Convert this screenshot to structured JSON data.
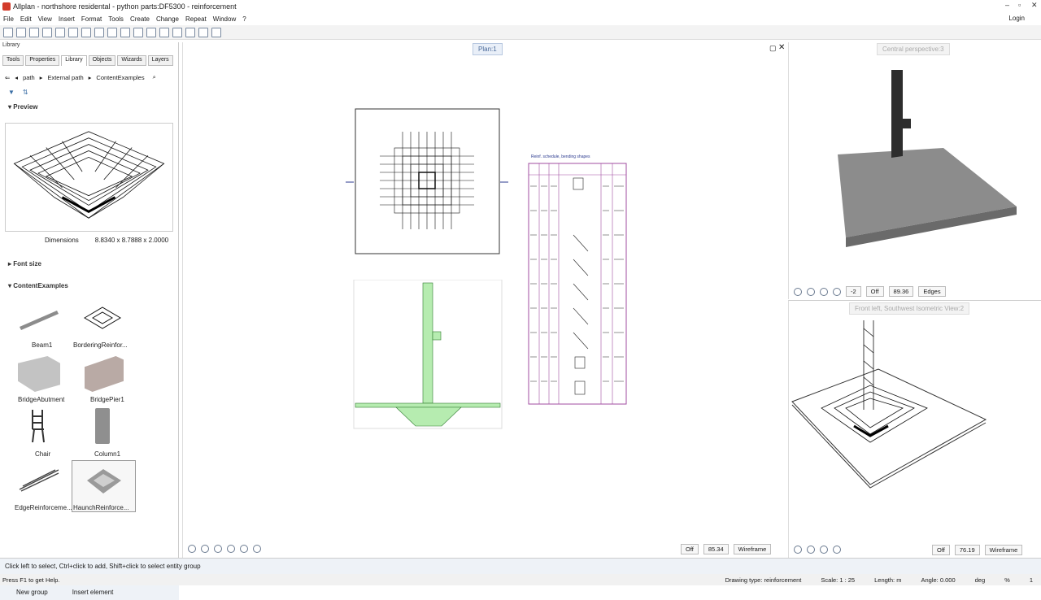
{
  "window": {
    "title": "Allplan - northshore residental - python parts:DF5300 - reinforcement"
  },
  "menu": [
    "File",
    "Edit",
    "View",
    "Insert",
    "Format",
    "Tools",
    "Create",
    "Change",
    "Repeat",
    "Window",
    "?"
  ],
  "login": "Login",
  "library": {
    "header": "Library",
    "tabs": [
      "Tools",
      "Properties",
      "Library",
      "Objects",
      "Wizards",
      "Layers"
    ],
    "active_tab": "Library",
    "breadcrumb": [
      "path",
      "External path",
      "ContentExamples"
    ],
    "preview_label": "Preview",
    "dimensions_label": "Dimensions",
    "dimensions_value": "8.8340 x 8.7888 x 2.0000",
    "font_size_label": "Font size",
    "content_label": "ContentExamples",
    "items": [
      "Beam1",
      "BorderingReinfor...",
      "BridgeAbutment",
      "BridgePier1",
      "Chair",
      "Column1",
      "EdgeReinforceme...",
      "HaunchReinforce..."
    ],
    "new_group": "New group",
    "insert_element": "Insert element"
  },
  "views": {
    "plan": "Plan:1",
    "perspective": "Central perspective:3",
    "iso": "Front left, Southwest Isometric View:2",
    "schedule_title": "Reinf. schedule, bending shapes"
  },
  "viewbar_main": {
    "off": "Off",
    "zoom": "85.34",
    "mode": "Wireframe"
  },
  "viewbar_top": {
    "minus": "-2",
    "off": "Off",
    "zoom": "89.36",
    "mode": "Edges"
  },
  "viewbar_bottom": {
    "off": "Off",
    "zoom": "76.19",
    "mode": "Wireframe"
  },
  "status": "Click left to select, Ctrl+click to add, Shift+click to select entity group",
  "footer": {
    "help": "Press F1 to get Help.",
    "drawing_type_label": "Drawing type:",
    "drawing_type": "reinforcement",
    "scale_label": "Scale:",
    "scale": "1 : 25",
    "length_label": "Length:",
    "length_unit": "m",
    "angle_label": "Angle:",
    "angle": "0.000",
    "angle_unit": "deg",
    "percent": "%",
    "pct_value": "1"
  }
}
